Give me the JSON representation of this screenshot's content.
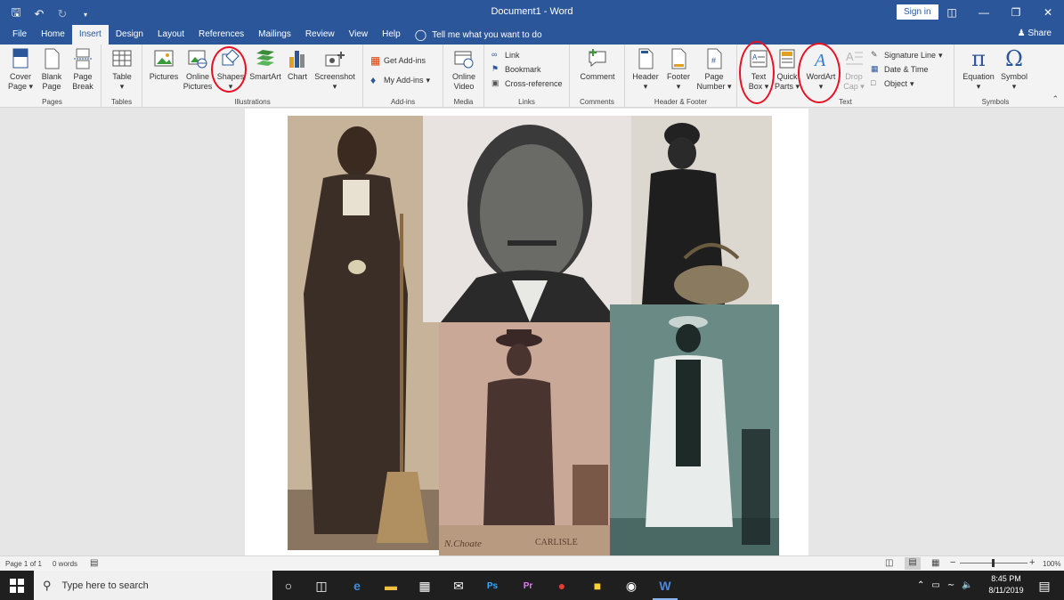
{
  "titlebar": {
    "title": "Document1  -  Word",
    "signin": "Sign in"
  },
  "tabs": [
    {
      "label": "File"
    },
    {
      "label": "Home"
    },
    {
      "label": "Insert"
    },
    {
      "label": "Design"
    },
    {
      "label": "Layout"
    },
    {
      "label": "References"
    },
    {
      "label": "Mailings"
    },
    {
      "label": "Review"
    },
    {
      "label": "View"
    },
    {
      "label": "Help"
    }
  ],
  "tellme": "Tell me what you want to do",
  "share": "Share",
  "ribbon": {
    "pages": {
      "label": "Pages",
      "cover": "Cover",
      "cover2": "Page",
      "blank": "Blank",
      "blank2": "Page",
      "break": "Page",
      "break2": "Break"
    },
    "tables": {
      "label": "Tables",
      "table": "Table"
    },
    "illustrations": {
      "label": "Illustrations",
      "pictures": "Pictures",
      "online": "Online",
      "online2": "Pictures",
      "shapes": "Shapes",
      "smartart": "SmartArt",
      "chart": "Chart",
      "screenshot": "Screenshot"
    },
    "addins": {
      "label": "Add-ins",
      "get": "Get Add-ins",
      "my": "My Add-ins"
    },
    "media": {
      "label": "Media",
      "online": "Online",
      "video": "Video"
    },
    "links": {
      "label": "Links",
      "link": "Link",
      "bookmark": "Bookmark",
      "crossref": "Cross-reference"
    },
    "comments": {
      "label": "Comments",
      "comment": "Comment"
    },
    "headerfooter": {
      "label": "Header & Footer",
      "header": "Header",
      "footer": "Footer",
      "page": "Page",
      "number": "Number"
    },
    "text": {
      "label": "Text",
      "textbox": "Text",
      "textbox2": "Box",
      "quick": "Quick",
      "quick2": "Parts",
      "wordart": "WordArt",
      "drop": "Drop",
      "drop2": "Cap",
      "signature": "Signature Line",
      "datetime": "Date & Time",
      "object": "Object"
    },
    "symbols": {
      "label": "Symbols",
      "equation": "Equation",
      "symbol": "Symbol"
    }
  },
  "statusbar": {
    "page": "Page 1 of 1",
    "words": "0 words",
    "zoom": "100%"
  },
  "taskbar": {
    "search_placeholder": "Type here to search",
    "time": "8:45 PM",
    "date": "8/11/2019"
  },
  "photos": {
    "caption_left": "N.Choate",
    "caption_right": "CARLISLE"
  },
  "colors": {
    "word_blue": "#2b579a",
    "highlight_red": "#e81123"
  }
}
